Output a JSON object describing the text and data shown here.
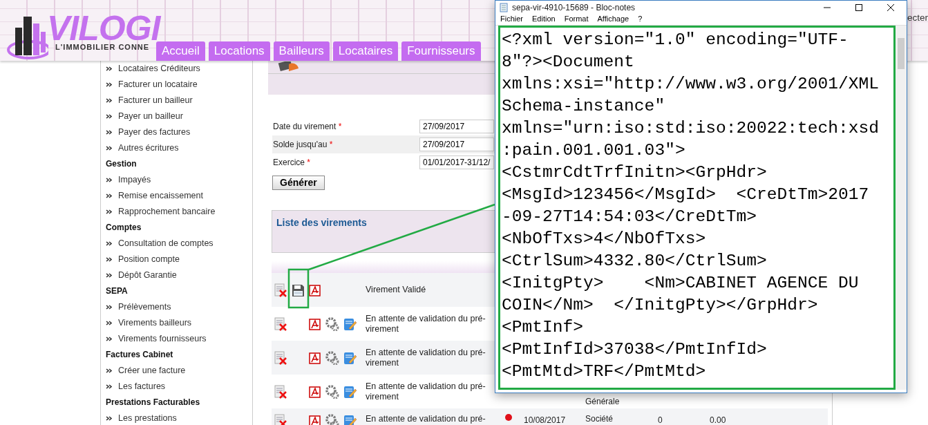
{
  "header": {
    "logo_text": "VILOGI",
    "logo_tagline": "L'IMMOBILIER CONNE",
    "nav": [
      {
        "label": "Accueil",
        "selected": false
      },
      {
        "label": "Locations",
        "selected": false
      },
      {
        "label": "Bailleurs",
        "selected": false
      },
      {
        "label": "Locataires",
        "selected": false
      },
      {
        "label": "Fournisseurs",
        "selected": false
      }
    ],
    "right_text": "ecter"
  },
  "sidebar": {
    "groups": [
      {
        "items": [
          "Locataires Créditeurs",
          "Facturer un locataire",
          "Facturer un bailleur",
          "Payer un bailleur",
          "Payer des factures",
          "Autres écritures"
        ]
      },
      {
        "title": "Gestion",
        "items": [
          "Impayés",
          "Remise encaissement",
          "Rapprochement bancaire"
        ]
      },
      {
        "title": "Comptes",
        "items": [
          "Consultation de comptes",
          "Position compte",
          "Dépôt Garantie"
        ]
      },
      {
        "title": "SEPA",
        "items": [
          "Prélèvements",
          "Virements bailleurs",
          "Virements fournisseurs"
        ]
      },
      {
        "title": "Factures Cabinet",
        "items": [
          "Créer une facture",
          "Les factures"
        ]
      },
      {
        "title": "Prestations Facturables",
        "items": [
          "Les prestations"
        ]
      }
    ]
  },
  "form": {
    "fields": [
      {
        "label": "Date du virement",
        "required_mark": "*",
        "value": "27/09/2017"
      },
      {
        "label": "Solde jusqu'au",
        "required_mark": "*",
        "value": "27/09/2017"
      },
      {
        "label": "Exercice",
        "required_mark": "*",
        "value": "01/01/2017-31/12/"
      }
    ],
    "submit": "Générer"
  },
  "transfers": {
    "title": "Liste des virements",
    "rows": [
      {
        "kind": "validated",
        "status": "Virement Validé"
      },
      {
        "kind": "pending",
        "status": "En attente de validation du pré-virement"
      },
      {
        "kind": "pending",
        "status": "En attente de validation du pré-virement"
      },
      {
        "kind": "pending",
        "status": "En attente de validation du pré-virement",
        "beneficiary": "Générale"
      },
      {
        "kind": "pending",
        "status": "En attente de validation du pré-",
        "color": "#e0101a",
        "date": "10/08/2017",
        "beneficiary": "Société",
        "count": "0",
        "amount": "0.00"
      }
    ]
  },
  "notepad": {
    "title": "sepa-vir-4910-15689 - Bloc-notes",
    "menu": [
      "Fichier",
      "Edition",
      "Format",
      "Affichage",
      "?"
    ],
    "lines": [
      "<?xml version=\"1.0\" encoding=\"UTF-",
      "8\"?><Document",
      "xmlns:xsi=\"http://www.w3.org/2001/XML",
      "Schema-instance\"",
      "xmlns=\"urn:iso:std:iso:20022:tech:xsd",
      ":pain.001.001.03\">",
      "<CstmrCdtTrfInitn><GrpHdr>",
      "<MsgId>123456</MsgId>  <CreDtTm>2017",
      "-09-27T14:54:03</CreDtTm>",
      "<NbOfTxs>4</NbOfTxs>",
      "<CtrlSum>4332.80</CtrlSum>",
      "<InitgPty>    <Nm>CABINET AGENCE DU",
      "COIN</Nm>  </InitgPty></GrpHdr>",
      "<PmtInf>",
      "<PmtInfId>37038</PmtInfId>",
      "<PmtMtd>TRF</PmtMtd>"
    ]
  }
}
